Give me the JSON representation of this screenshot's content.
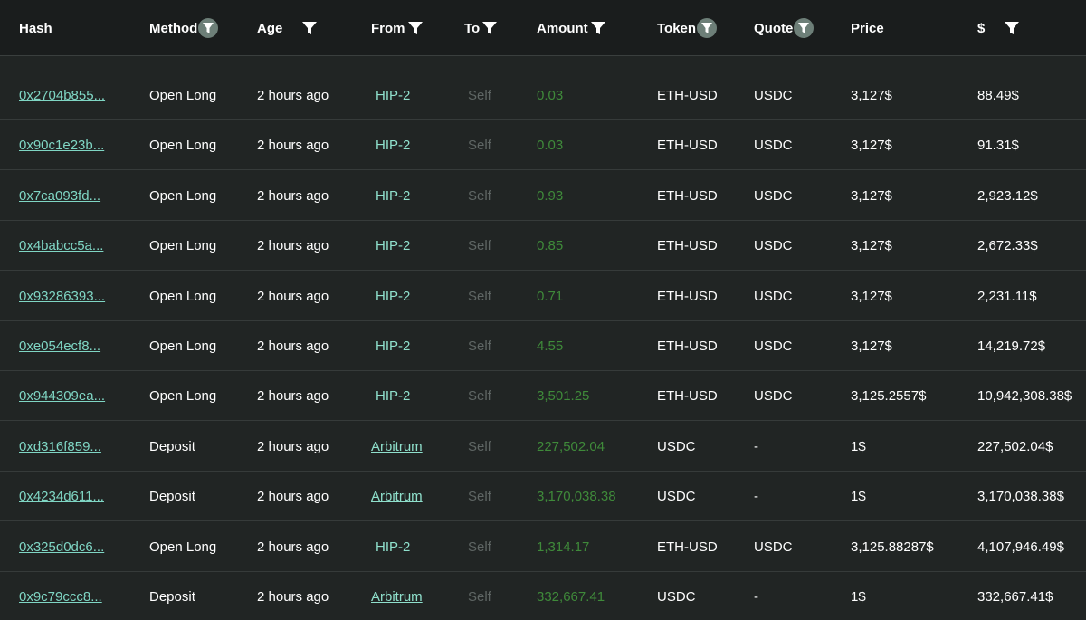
{
  "headers": {
    "hash": "Hash",
    "method": "Method",
    "age": "Age",
    "from": "From",
    "to": "To",
    "amount": "Amount",
    "token": "Token",
    "quote": "Quote",
    "price": "Price",
    "usd": "$"
  },
  "colors": {
    "background": "#212524",
    "header_background": "#1a1d1d",
    "hash_link": "#7fd6c4",
    "from": "#8fe0cc",
    "amount": "#3f8a3a",
    "to_muted": "#5f6664",
    "filter_circle": "#6d7f78"
  },
  "rows": [
    {
      "hash": "0x2704b855...",
      "method": "Open Long",
      "age": "2 hours ago",
      "from": "HIP-2",
      "to": "Self",
      "amount": "0.03",
      "token": "ETH-USD",
      "quote": "USDC",
      "price": "3,127$",
      "usd": "88.49$"
    },
    {
      "hash": "0x90c1e23b...",
      "method": "Open Long",
      "age": "2 hours ago",
      "from": "HIP-2",
      "to": "Self",
      "amount": "0.03",
      "token": "ETH-USD",
      "quote": "USDC",
      "price": "3,127$",
      "usd": "91.31$"
    },
    {
      "hash": "0x7ca093fd...",
      "method": "Open Long",
      "age": "2 hours ago",
      "from": "HIP-2",
      "to": "Self",
      "amount": "0.93",
      "token": "ETH-USD",
      "quote": "USDC",
      "price": "3,127$",
      "usd": "2,923.12$"
    },
    {
      "hash": "0x4babcc5a...",
      "method": "Open Long",
      "age": "2 hours ago",
      "from": "HIP-2",
      "to": "Self",
      "amount": "0.85",
      "token": "ETH-USD",
      "quote": "USDC",
      "price": "3,127$",
      "usd": "2,672.33$"
    },
    {
      "hash": "0x93286393...",
      "method": "Open Long",
      "age": "2 hours ago",
      "from": "HIP-2",
      "to": "Self",
      "amount": "0.71",
      "token": "ETH-USD",
      "quote": "USDC",
      "price": "3,127$",
      "usd": "2,231.11$"
    },
    {
      "hash": "0xe054ecf8...",
      "method": "Open Long",
      "age": "2 hours ago",
      "from": "HIP-2",
      "to": "Self",
      "amount": "4.55",
      "token": "ETH-USD",
      "quote": "USDC",
      "price": "3,127$",
      "usd": "14,219.72$"
    },
    {
      "hash": "0x944309ea...",
      "method": "Open Long",
      "age": "2 hours ago",
      "from": "HIP-2",
      "to": "Self",
      "amount": "3,501.25",
      "token": "ETH-USD",
      "quote": "USDC",
      "price": "3,125.2557$",
      "usd": "10,942,308.38$"
    },
    {
      "hash": "0xd316f859...",
      "method": "Deposit",
      "age": "2 hours ago",
      "from": "Arbitrum",
      "to": "Self",
      "amount": "227,502.04",
      "token": "USDC",
      "quote": "-",
      "price": "1$",
      "usd": "227,502.04$"
    },
    {
      "hash": "0x4234d611...",
      "method": "Deposit",
      "age": "2 hours ago",
      "from": "Arbitrum",
      "to": "Self",
      "amount": "3,170,038.38",
      "token": "USDC",
      "quote": "-",
      "price": "1$",
      "usd": "3,170,038.38$"
    },
    {
      "hash": "0x325d0dc6...",
      "method": "Open Long",
      "age": "2 hours ago",
      "from": "HIP-2",
      "to": "Self",
      "amount": "1,314.17",
      "token": "ETH-USD",
      "quote": "USDC",
      "price": "3,125.88287$",
      "usd": "4,107,946.49$"
    },
    {
      "hash": "0x9c79ccc8...",
      "method": "Deposit",
      "age": "2 hours ago",
      "from": "Arbitrum",
      "to": "Self",
      "amount": "332,667.41",
      "token": "USDC",
      "quote": "-",
      "price": "1$",
      "usd": "332,667.41$"
    }
  ]
}
